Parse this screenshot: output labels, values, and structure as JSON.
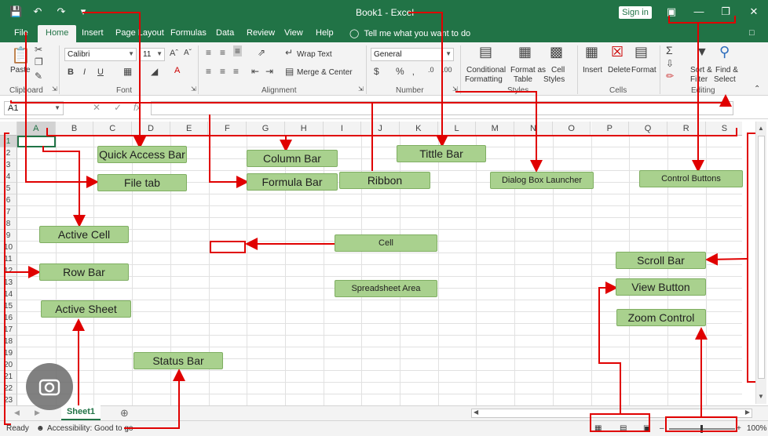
{
  "titlebar": {
    "title": "Book1  -  Excel",
    "signin": "Sign in"
  },
  "tabs": [
    "File",
    "Home",
    "Insert",
    "Page Layout",
    "Formulas",
    "Data",
    "Review",
    "View",
    "Help"
  ],
  "tell_me": "Tell me what you want to do",
  "ribbon": {
    "paste": "Paste",
    "font_name": "Calibri",
    "font_size": "11",
    "wrap_text": "Wrap Text",
    "merge_center": "Merge & Center",
    "number_format": "General",
    "conditional": [
      "Conditional",
      "Formatting"
    ],
    "format_table": [
      "Format as",
      "Table"
    ],
    "cell_styles": [
      "Cell",
      "Styles"
    ],
    "insert": "Insert",
    "delete": "Delete",
    "format": "Format",
    "sort_filter": [
      "Sort &",
      "Filter"
    ],
    "find_select": [
      "Find &",
      "Select"
    ],
    "groups": [
      "Clipboard",
      "Font",
      "Alignment",
      "Number",
      "Styles",
      "Cells",
      "Editing"
    ]
  },
  "formula_bar": {
    "name_box": "A1",
    "fx": "fx"
  },
  "grid": {
    "columns": [
      "A",
      "B",
      "C",
      "D",
      "E",
      "F",
      "G",
      "H",
      "I",
      "J",
      "K",
      "L",
      "M",
      "N",
      "O",
      "P",
      "Q",
      "R",
      "S"
    ],
    "rows": [
      "1",
      "2",
      "3",
      "4",
      "5",
      "6",
      "7",
      "8",
      "9",
      "10",
      "11",
      "12",
      "13",
      "14",
      "15",
      "16",
      "17",
      "18",
      "19",
      "20",
      "21",
      "22",
      "23"
    ]
  },
  "sheet": {
    "tab": "Sheet1"
  },
  "status": {
    "ready": "Ready",
    "accessibility": "Accessibility: Good to go",
    "zoom": "100%"
  },
  "labels": {
    "quick_access": "Quick Access Bar",
    "column_bar": "Column Bar",
    "title_bar": "Tittle Bar",
    "file_tab": "File tab",
    "formula_bar": "Formula Bar",
    "ribbon": "Ribbon",
    "dialog_launcher": "Dialog Box Launcher",
    "control_buttons": "Control Buttons",
    "active_cell": "Active Cell",
    "cell": "Cell",
    "scroll_bar": "Scroll Bar",
    "row_bar": "Row Bar",
    "spreadsheet_area": "Spreadsheet Area",
    "view_button": "View Button",
    "active_sheet": "Active Sheet",
    "zoom_control": "Zoom Control",
    "status_bar": "Status Bar"
  },
  "colors": {
    "excel_green": "#217346",
    "label_fill": "#a9d18e",
    "arrow": "#e00000"
  }
}
